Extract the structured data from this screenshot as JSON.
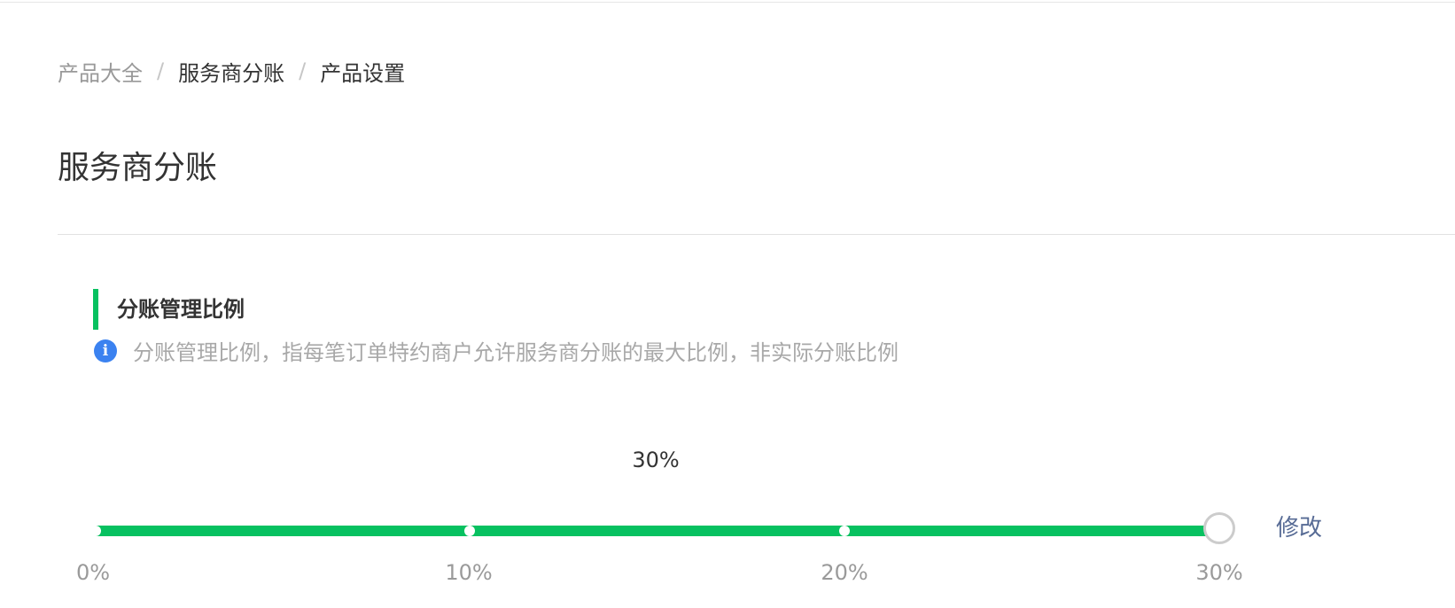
{
  "breadcrumb": {
    "items": [
      "产品大全",
      "服务商分账",
      "产品设置"
    ],
    "separator": "/"
  },
  "page": {
    "title": "服务商分账"
  },
  "section": {
    "heading": "分账管理比例",
    "accent_color": "#07c160",
    "info_icon": "info-icon",
    "info_glyph": "i",
    "info_text": "分账管理比例，指每笔订单特约商户允许服务商分账的最大比例，非实际分账比例"
  },
  "slider": {
    "current_label": "30%",
    "current_value": 30,
    "min": 0,
    "max": 30,
    "ticks": [
      "0%",
      "10%",
      "20%",
      "30%"
    ],
    "fill_color": "#07c160"
  },
  "actions": {
    "edit_label": "修改",
    "link_color": "#576b95"
  }
}
